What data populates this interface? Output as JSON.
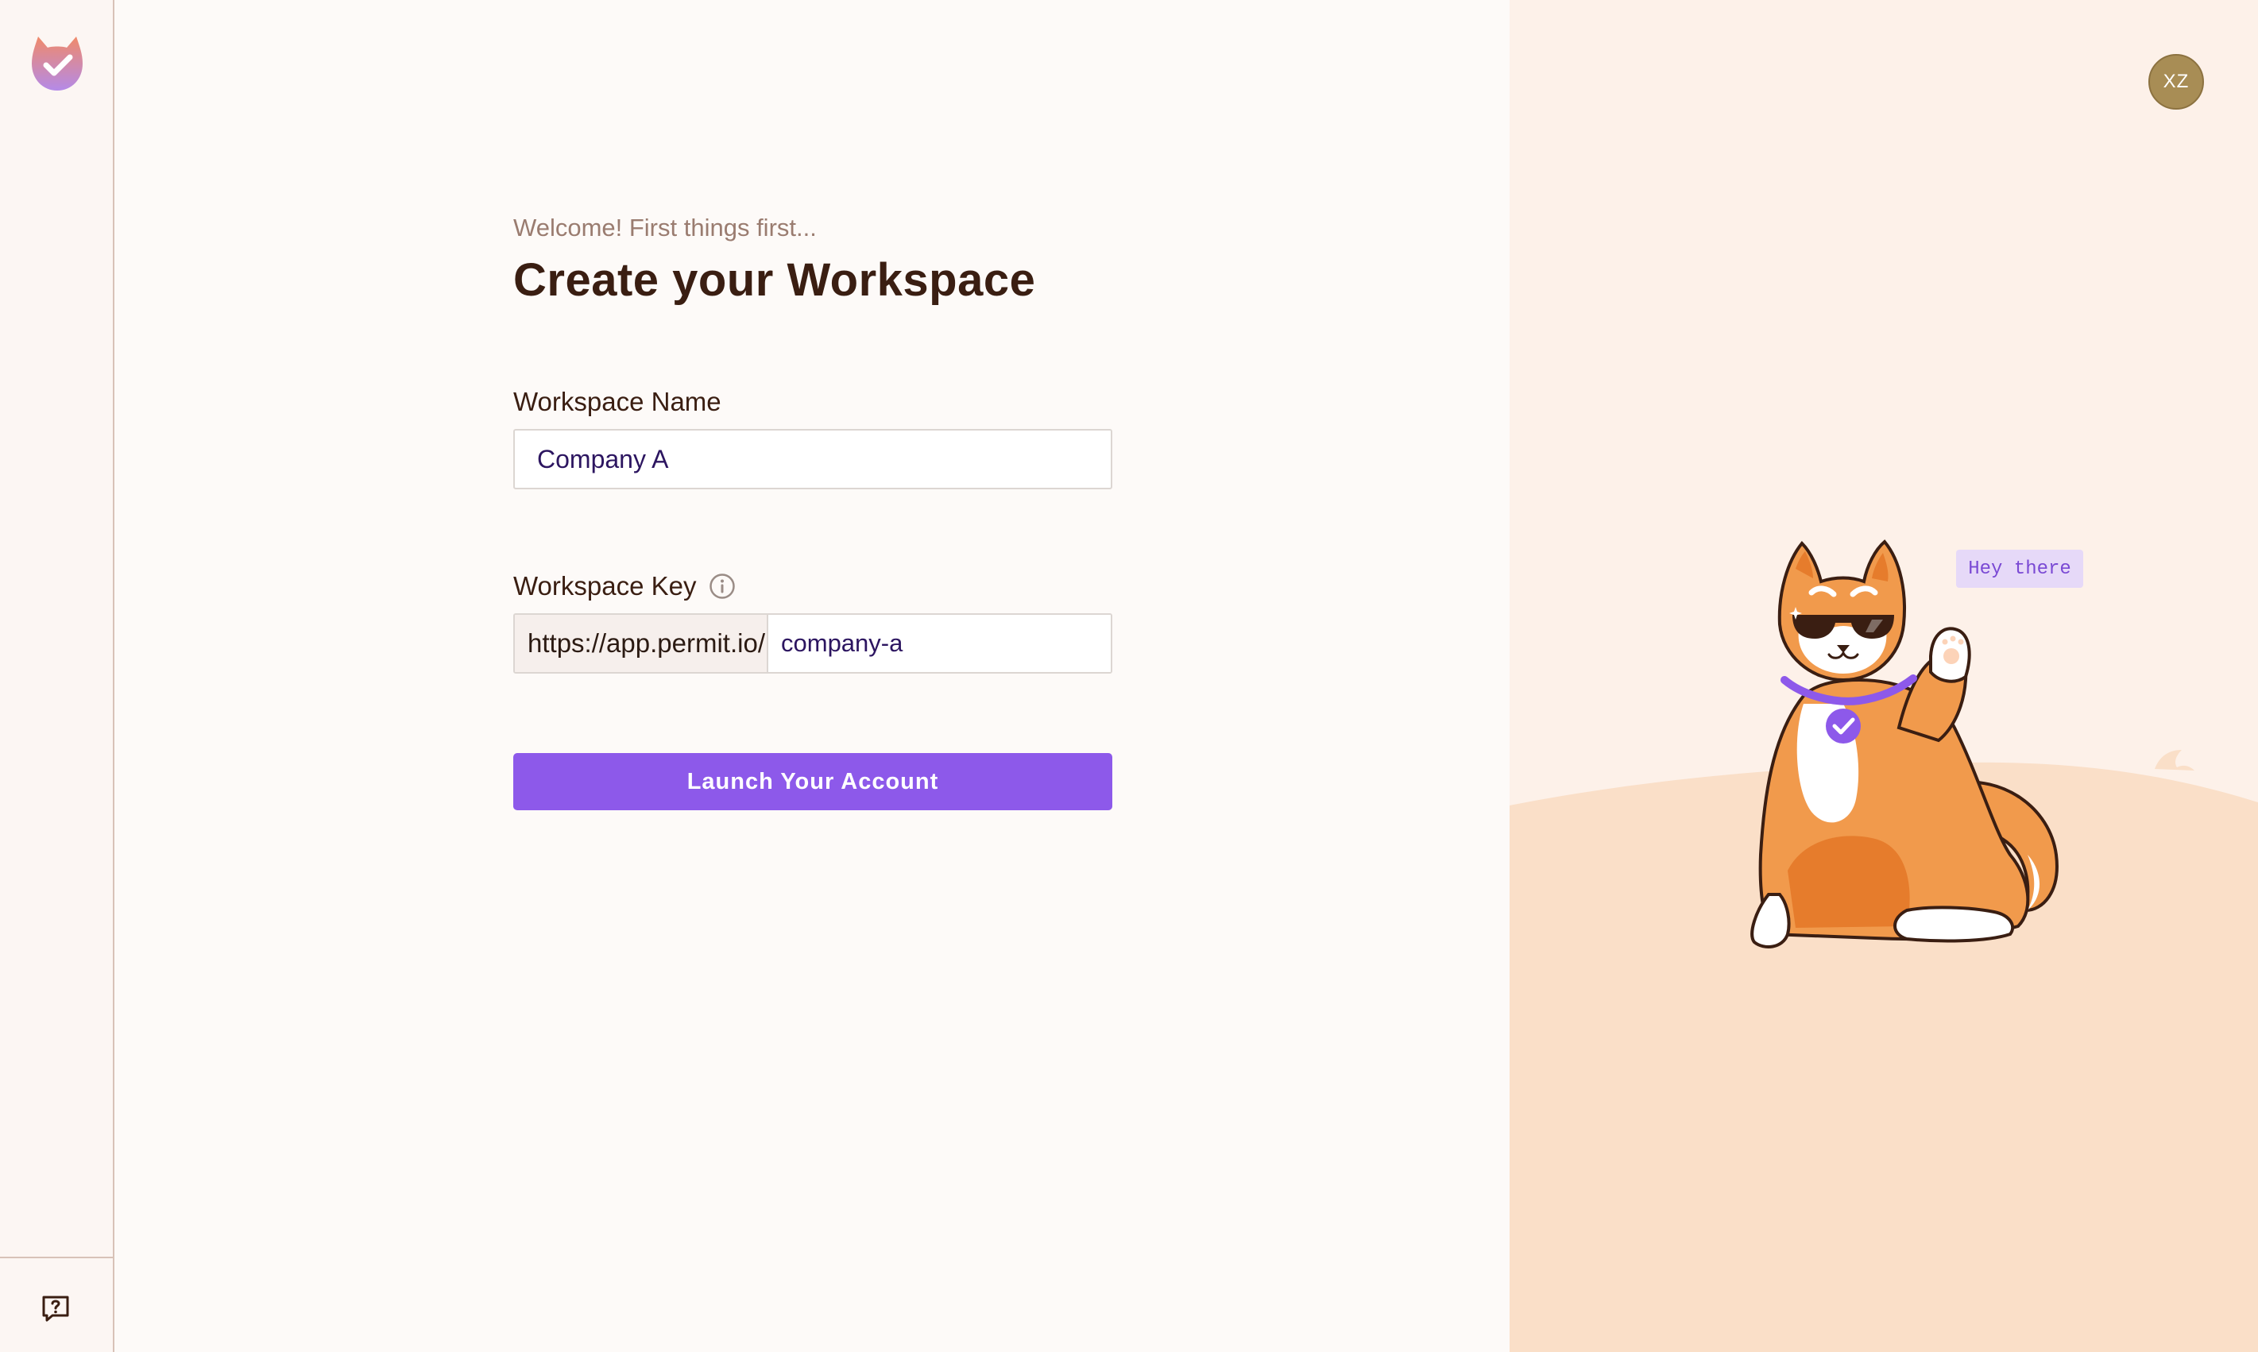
{
  "sidebar": {
    "logo_icon": "permit-cat-logo-icon",
    "help_icon": "help-question-icon"
  },
  "form": {
    "welcome_text": "Welcome! First things first...",
    "title": "Create your Workspace",
    "workspace_name": {
      "label": "Workspace Name",
      "value": "Company A"
    },
    "workspace_key": {
      "label": "Workspace Key",
      "info_icon": "info-icon",
      "prefix": "https://app.permit.io/",
      "value": "company-a"
    },
    "launch_button": "Launch Your Account"
  },
  "user": {
    "avatar_initials": "XZ"
  },
  "illustration": {
    "speech_text": "Hey there"
  },
  "colors": {
    "accent": "#8d59ea",
    "title": "#3a1e12",
    "muted": "#9a7c70",
    "cat_orange": "#f19a4c",
    "hill": "#fadfc8",
    "panel_bg": "#fdf1e9"
  }
}
